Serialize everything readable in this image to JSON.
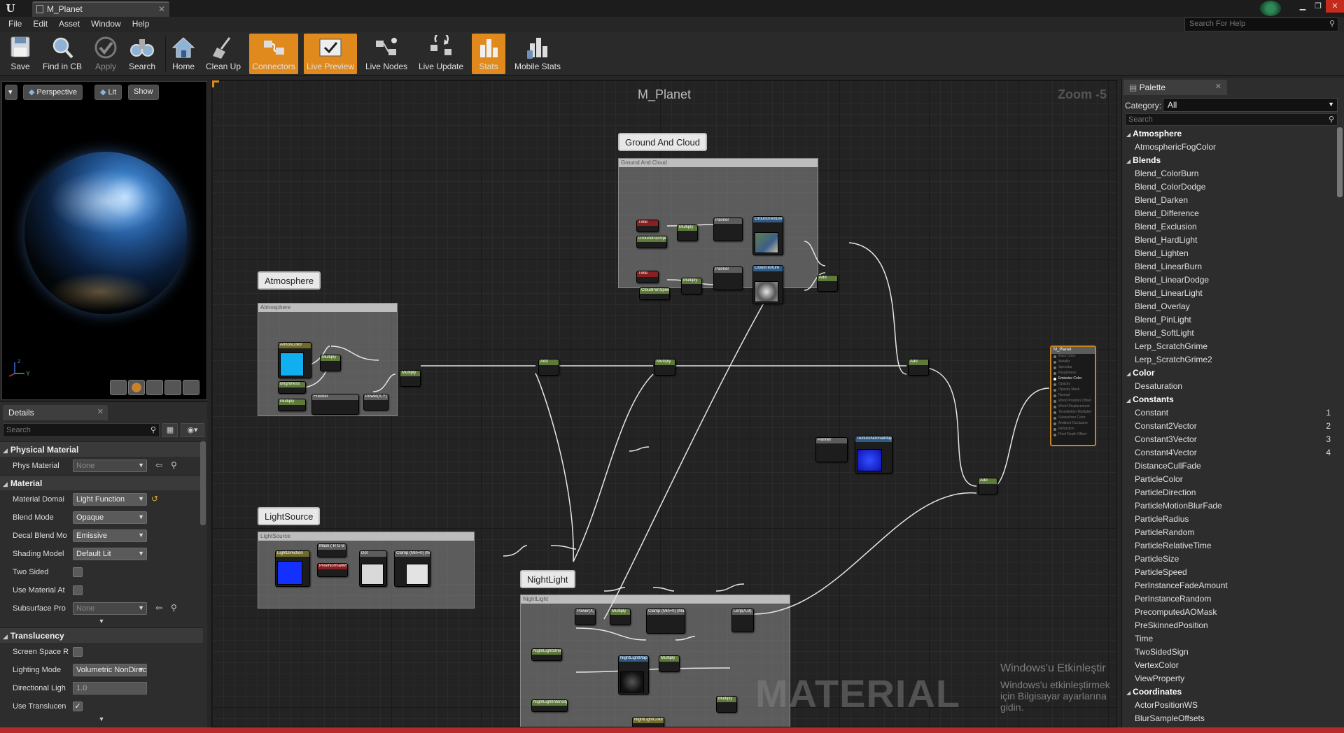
{
  "window": {
    "tab_title": "M_Planet",
    "help_search_placeholder": "Search For Help"
  },
  "menu": [
    "File",
    "Edit",
    "Asset",
    "Window",
    "Help"
  ],
  "toolbar": [
    {
      "label": "Save",
      "icon": "save-icon",
      "state": "normal"
    },
    {
      "label": "Find in CB",
      "icon": "magnifier-icon",
      "state": "normal"
    },
    {
      "label": "Apply",
      "icon": "checkmark-icon",
      "state": "disabled"
    },
    {
      "label": "Search",
      "icon": "binoculars-icon",
      "state": "normal"
    },
    {
      "label": "Home",
      "icon": "home-icon",
      "state": "normal"
    },
    {
      "label": "Clean Up",
      "icon": "broom-icon",
      "state": "normal"
    },
    {
      "label": "Connectors",
      "icon": "connectors-icon",
      "state": "active"
    },
    {
      "label": "Live Preview",
      "icon": "live-preview-icon",
      "state": "active"
    },
    {
      "label": "Live Nodes",
      "icon": "live-nodes-icon",
      "state": "normal"
    },
    {
      "label": "Live Update",
      "icon": "live-update-icon",
      "state": "normal"
    },
    {
      "label": "Stats",
      "icon": "stats-icon",
      "state": "active"
    },
    {
      "label": "Mobile Stats",
      "icon": "mobile-stats-icon",
      "state": "normal"
    }
  ],
  "viewport": {
    "perspective_label": "Perspective",
    "lit_label": "Lit",
    "show_label": "Show",
    "axis_z": "z",
    "axis_y": "Y"
  },
  "details": {
    "tab_label": "Details",
    "search_placeholder": "Search",
    "sections": [
      {
        "title": "Physical Material",
        "rows": [
          {
            "label": "Phys Material",
            "type": "combo",
            "value": "None",
            "dim": true,
            "icons": true
          }
        ]
      },
      {
        "title": "Material",
        "rows": [
          {
            "label": "Material Domai",
            "type": "combo",
            "value": "Light Function",
            "dim": false,
            "reset": true
          },
          {
            "label": "Blend Mode",
            "type": "combo",
            "value": "Opaque",
            "dim": false
          },
          {
            "label": "Decal Blend Mo",
            "type": "combo",
            "value": "Emissive",
            "dim": false
          },
          {
            "label": "Shading Model",
            "type": "combo",
            "value": "Default Lit",
            "dim": false
          },
          {
            "label": "Two Sided",
            "type": "check",
            "checked": false
          },
          {
            "label": "Use Material At",
            "type": "check",
            "checked": false
          },
          {
            "label": "Subsurface Pro",
            "type": "combo",
            "value": "None",
            "dim": true,
            "icons": true
          }
        ]
      },
      {
        "title": "Translucency",
        "rows": [
          {
            "label": "Screen Space R",
            "type": "check",
            "checked": false
          },
          {
            "label": "Lighting Mode",
            "type": "combo",
            "value": "Volumetric NonDirectional",
            "dim": false
          },
          {
            "label": "Directional Ligh",
            "type": "number",
            "value": "1.0"
          },
          {
            "label": "Use Translucen",
            "type": "check",
            "checked": true
          }
        ]
      }
    ]
  },
  "graph": {
    "title": "M_Planet",
    "zoom": "Zoom -5",
    "comments": [
      {
        "label": "Ground And Cloud",
        "box_title": "Ground And Cloud"
      },
      {
        "label": "Atmosphere",
        "box_title": "Atmosphere"
      },
      {
        "label": "LightSource",
        "box_title": "LightSource"
      },
      {
        "label": "NightLight",
        "box_title": "NightLight"
      }
    ],
    "nodes": [
      {
        "title": "Time",
        "color": "red"
      },
      {
        "title": "GroundPanSpeed",
        "color": "green"
      },
      {
        "title": "Multiply",
        "color": "green"
      },
      {
        "title": "Panner",
        "color": "gray"
      },
      {
        "title": "GroundTexture",
        "color": "blue"
      },
      {
        "title": "Time",
        "color": "red"
      },
      {
        "title": "CloudPanSpeed",
        "color": "green"
      },
      {
        "title": "Multiply",
        "color": "green"
      },
      {
        "title": "Panner",
        "color": "gray"
      },
      {
        "title": "CloudTexture",
        "color": "blue"
      },
      {
        "title": "Add",
        "color": "green"
      },
      {
        "title": "AtmosColor",
        "color": "olive"
      },
      {
        "title": "Multiply",
        "color": "green"
      },
      {
        "title": "Brightness",
        "color": "green"
      },
      {
        "title": "Fresnel",
        "color": "gray"
      },
      {
        "title": "Power(X,Y)",
        "color": "gray"
      },
      {
        "title": "Multiply",
        "color": "green"
      },
      {
        "title": "Multiply",
        "color": "green"
      },
      {
        "title": "Add",
        "color": "green"
      },
      {
        "title": "Multiply",
        "color": "green"
      },
      {
        "title": "Panner",
        "color": "gray"
      },
      {
        "title": "TextureNormalMap",
        "color": "blue"
      },
      {
        "title": "Add",
        "color": "green"
      },
      {
        "title": "LightDirection",
        "color": "olive"
      },
      {
        "title": "Mask ( R G B )",
        "color": "gray"
      },
      {
        "title": "PixelNormalWS",
        "color": "red"
      },
      {
        "title": "Dot",
        "color": "gray"
      },
      {
        "title": "Clamp (Min=0) (Max=1)",
        "color": "gray"
      },
      {
        "title": "Power(X,Y)",
        "color": "gray"
      },
      {
        "title": "Multiply",
        "color": "green"
      },
      {
        "title": "Clamp (Min=0) (Max=1)",
        "color": "gray"
      },
      {
        "title": "Lerp(A,B)",
        "color": "gray"
      },
      {
        "title": "NightLightStrength",
        "color": "green"
      },
      {
        "title": "NightLightMap",
        "color": "blue"
      },
      {
        "title": "Multiply",
        "color": "green"
      },
      {
        "title": "NightLightIntensity",
        "color": "green"
      },
      {
        "title": "Multiply",
        "color": "green"
      },
      {
        "title": "NightLightColor",
        "color": "olive"
      }
    ],
    "output_node": {
      "title": "M_Planet",
      "pins": [
        "Base Color",
        "Metallic",
        "Specular",
        "Roughness",
        "Emissive Color",
        "Opacity",
        "Opacity Mask",
        "Normal",
        "World Position Offset",
        "World Displacement",
        "Tessellation Multiplier",
        "Subsurface Color",
        "Ambient Occlusion",
        "Refraction",
        "Pixel Depth Offset"
      ],
      "active_pin": "Emissive Color"
    },
    "watermark": "MATERIAL",
    "windows_notice_title": "Windows'u Etkinleştir",
    "windows_notice_body": "Windows'u etkinleştirmek için Bilgisayar ayarlarına gidin."
  },
  "palette": {
    "tab_label": "Palette",
    "category_label": "Category:",
    "category_value": "All",
    "search_placeholder": "Search",
    "groups": [
      {
        "name": "Atmosphere",
        "items": [
          "AtmosphericFogColor"
        ]
      },
      {
        "name": "Blends",
        "items": [
          "Blend_ColorBurn",
          "Blend_ColorDodge",
          "Blend_Darken",
          "Blend_Difference",
          "Blend_Exclusion",
          "Blend_HardLight",
          "Blend_Lighten",
          "Blend_LinearBurn",
          "Blend_LinearDodge",
          "Blend_LinearLight",
          "Blend_Overlay",
          "Blend_PinLight",
          "Blend_SoftLight",
          "Lerp_ScratchGrime",
          "Lerp_ScratchGrime2"
        ]
      },
      {
        "name": "Color",
        "items": [
          "Desaturation"
        ]
      },
      {
        "name": "Constants",
        "items": [
          "Constant",
          "Constant2Vector",
          "Constant3Vector",
          "Constant4Vector",
          "DistanceCullFade",
          "ParticleColor",
          "ParticleDirection",
          "ParticleMotionBlurFade",
          "ParticleRadius",
          "ParticleRandom",
          "ParticleRelativeTime",
          "ParticleSize",
          "ParticleSpeed",
          "PerInstanceFadeAmount",
          "PerInstanceRandom",
          "PrecomputedAOMask",
          "PreSkinnedPosition",
          "Time",
          "TwoSidedSign",
          "VertexColor",
          "ViewProperty"
        ],
        "hotkeys": {
          "Constant": "1",
          "Constant2Vector": "2",
          "Constant3Vector": "3",
          "Constant4Vector": "4"
        }
      },
      {
        "name": "Coordinates",
        "items": [
          "ActorPositionWS",
          "BlurSampleOffsets"
        ]
      }
    ]
  },
  "colors": {
    "accent_orange": "#e08a1e",
    "panel": "#2d2d2d",
    "graph_bg": "#232323"
  }
}
